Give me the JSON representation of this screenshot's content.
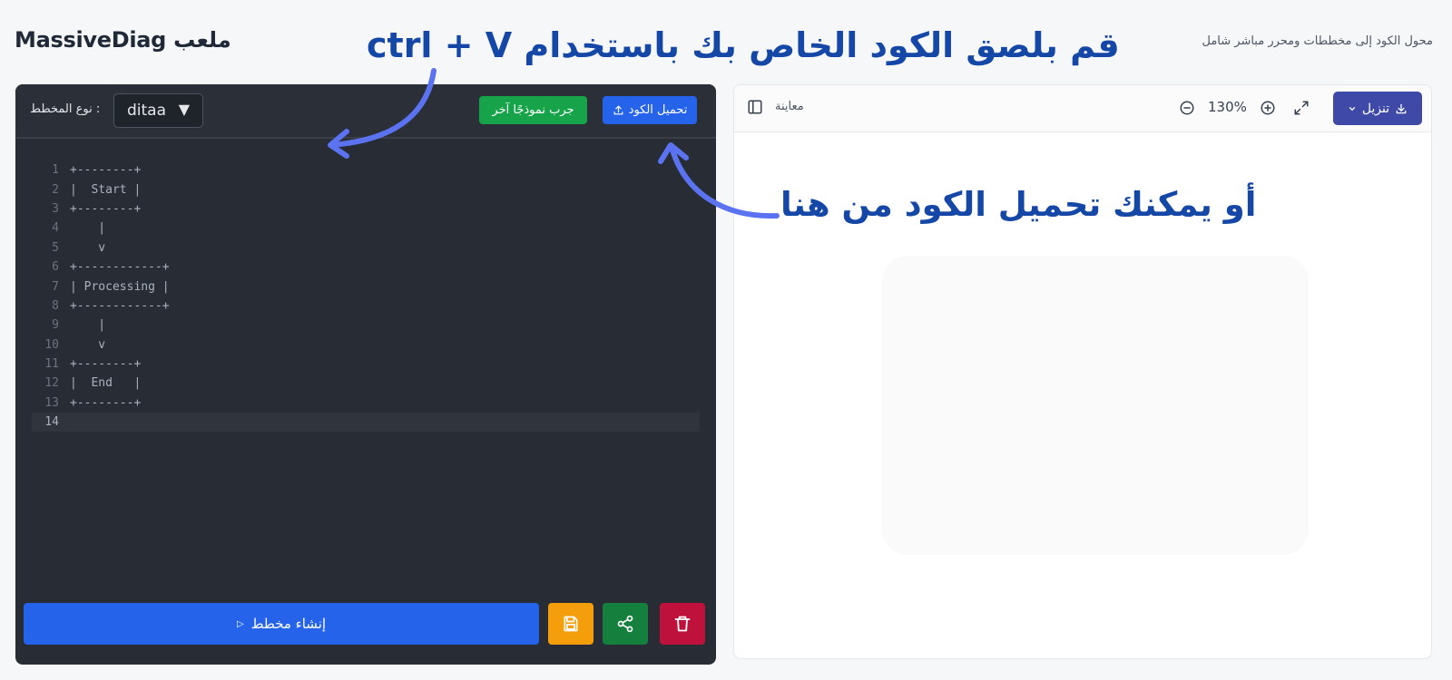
{
  "header": {
    "title": "MassiveDiag ملعب",
    "subtitle": "محول الكود إلى مخططات ومحرر مباشر شامل"
  },
  "annotations": {
    "top": "ctrl + V قم بلصق الكود الخاص بك باستخدام",
    "right": "أو يمكنك تحميل الكود من هنا",
    "color": "#1447a6",
    "arrow_color": "#5b73f0"
  },
  "editor": {
    "type_label": ": نوع المخطط",
    "type_value": "ditaa",
    "try_sample_label": "جرب نموذجًا آخر",
    "upload_label": "تحميل الكود",
    "lines": [
      {
        "n": "1",
        "text": "+--------+"
      },
      {
        "n": "2",
        "text": "|  Start |"
      },
      {
        "n": "3",
        "text": "+--------+"
      },
      {
        "n": "4",
        "text": "    |"
      },
      {
        "n": "5",
        "text": "    v"
      },
      {
        "n": "6",
        "text": "+------------+"
      },
      {
        "n": "7",
        "text": "| Processing |"
      },
      {
        "n": "8",
        "text": "+------------+"
      },
      {
        "n": "9",
        "text": "    |"
      },
      {
        "n": "10",
        "text": "    v"
      },
      {
        "n": "11",
        "text": "+--------+"
      },
      {
        "n": "12",
        "text": "|  End   |"
      },
      {
        "n": "13",
        "text": "+--------+"
      },
      {
        "n": "14",
        "text": ""
      }
    ],
    "generate_label": "إنشاء مخطط",
    "colors": {
      "background": "#282c34",
      "generate": "#2563eb",
      "save": "#f59e0b",
      "share": "#15803d",
      "delete": "#be123c"
    }
  },
  "preview": {
    "label": "معاينة",
    "zoom_level": "130%",
    "download_label": "تنزيل",
    "download_color": "#3f4aa8"
  }
}
